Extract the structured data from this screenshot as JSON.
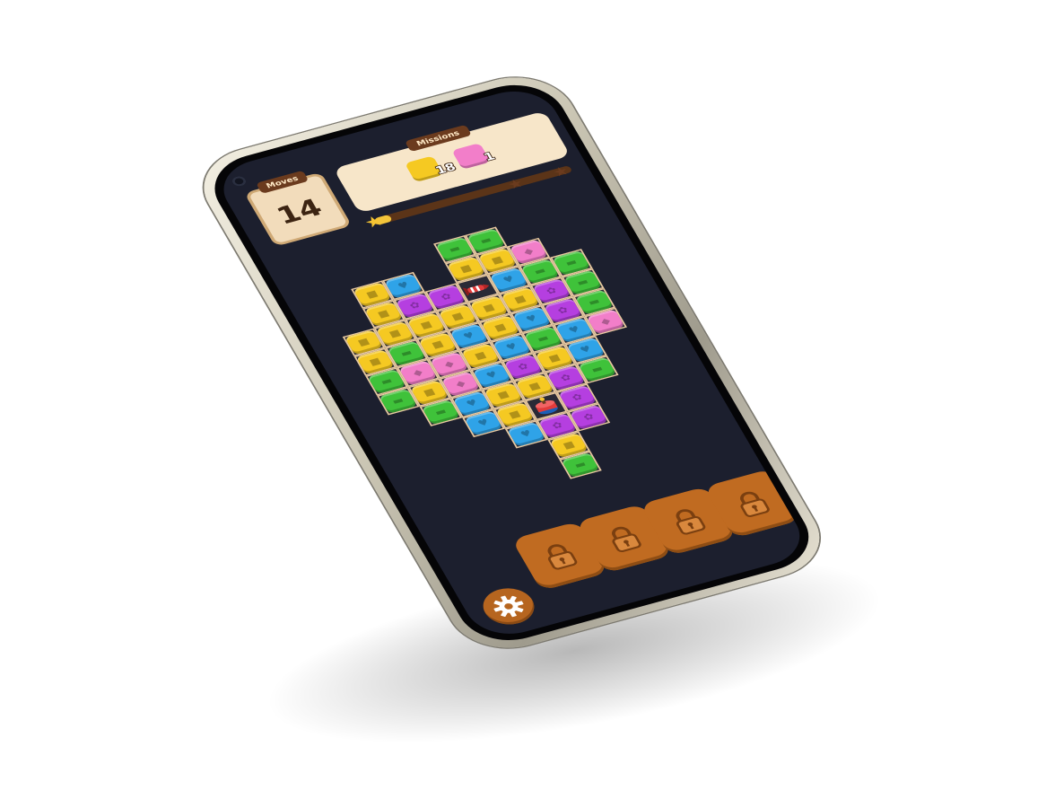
{
  "hud": {
    "moves_label": "Moves",
    "moves_value": "14",
    "missions_label": "Missions",
    "missions": [
      {
        "tile": "yellow",
        "count": "18"
      },
      {
        "tile": "pink",
        "count": "1"
      }
    ],
    "progress": 0.08
  },
  "colors": {
    "yellow": "#f5c922",
    "blue": "#2fa3e8",
    "purple": "#b53fe0",
    "green": "#3fc23a",
    "pink": "#f27ec9",
    "board_bg": "#1c1f2e",
    "accent": "#c06b21"
  },
  "board": {
    "rows": [
      [
        null,
        null,
        null,
        null,
        "green",
        "green",
        null,
        null,
        null
      ],
      [
        null,
        "yellow",
        "blue",
        null,
        "yellow",
        "yellow",
        "pink",
        null,
        null
      ],
      [
        null,
        "yellow",
        "purple",
        "purple",
        "rocket",
        "blue",
        "green",
        "green",
        null
      ],
      [
        "yellow",
        "yellow",
        "yellow",
        "yellow",
        "yellow",
        "yellow",
        "purple",
        "green",
        null
      ],
      [
        "yellow",
        "green",
        "yellow",
        "blue",
        "yellow",
        "blue",
        "purple",
        "green",
        null
      ],
      [
        "green",
        "pink",
        "pink",
        "yellow",
        "blue",
        "green",
        "blue",
        "pink",
        null
      ],
      [
        "green",
        "yellow",
        "pink",
        "blue",
        "purple",
        "yellow",
        "blue",
        null,
        null
      ],
      [
        null,
        "green",
        "blue",
        "yellow",
        "yellow",
        "purple",
        "green",
        null,
        null
      ],
      [
        null,
        null,
        "blue",
        "yellow",
        "bomb",
        "purple",
        null,
        null,
        null
      ],
      [
        null,
        null,
        null,
        "blue",
        "purple",
        "purple",
        null,
        null,
        null
      ],
      [
        null,
        null,
        null,
        null,
        "yellow",
        null,
        null,
        null,
        null
      ],
      [
        null,
        null,
        null,
        null,
        "green",
        null,
        null,
        null,
        null
      ]
    ]
  },
  "icons": {
    "settings": "gear-icon",
    "locked_slot": "padlock-icon",
    "special_1": "rocket-icon",
    "special_2": "bomb-icon"
  },
  "locked_slots": 4
}
